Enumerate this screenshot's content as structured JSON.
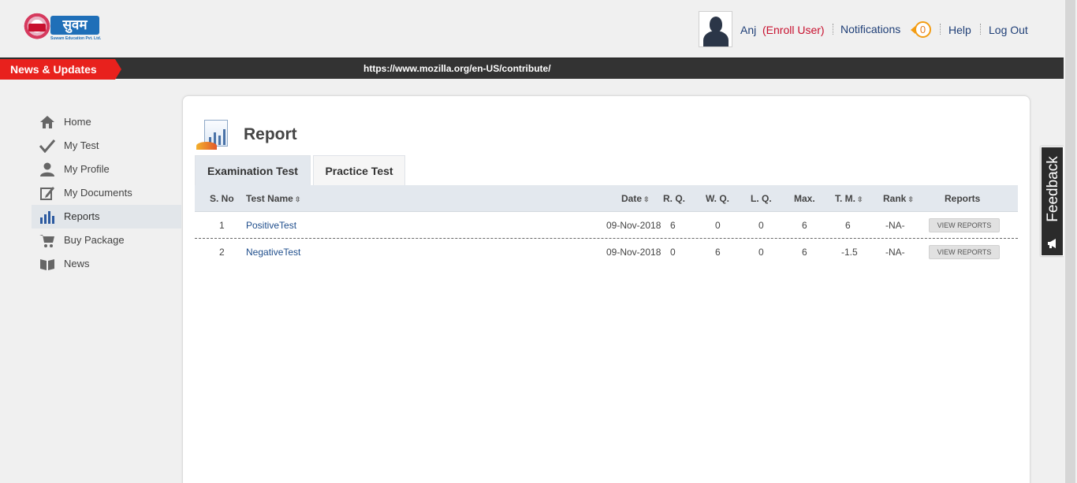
{
  "header": {
    "logo_word": "सुवम",
    "logo_subtitle": "Suwam Education Pvt. Ltd.",
    "user_name": "Anj",
    "user_role": "(Enroll User)",
    "notifications_label": "Notifications",
    "notifications_count": "0",
    "help_label": "Help",
    "logout_label": "Log Out"
  },
  "news": {
    "label": "News & Updates",
    "ticker": "https://www.mozilla.org/en-US/contribute/"
  },
  "sidebar": {
    "items": [
      {
        "label": "Home",
        "icon": "home-icon"
      },
      {
        "label": "My Test",
        "icon": "check-icon"
      },
      {
        "label": "My Profile",
        "icon": "user-icon"
      },
      {
        "label": "My Documents",
        "icon": "edit-document-icon"
      },
      {
        "label": "Reports",
        "icon": "bar-chart-icon",
        "active": true
      },
      {
        "label": "Buy Package",
        "icon": "cart-icon"
      },
      {
        "label": "News",
        "icon": "book-icon"
      }
    ]
  },
  "main": {
    "title": "Report",
    "tabs": [
      {
        "label": "Examination Test",
        "active": true
      },
      {
        "label": "Practice Test",
        "active": false
      }
    ],
    "columns": {
      "sno": "S. No",
      "test_name": "Test Name",
      "date": "Date",
      "rq": "R. Q.",
      "wq": "W. Q.",
      "lq": "L. Q.",
      "max": "Max.",
      "tm": "T. M.",
      "rank": "Rank",
      "reports": "Reports"
    },
    "rows": [
      {
        "sno": "1",
        "test_name": "PositiveTest",
        "date": "09-Nov-2018",
        "rq": "6",
        "wq": "0",
        "lq": "0",
        "max": "6",
        "tm": "6",
        "rank": "-NA-",
        "action": "VIEW REPORTS"
      },
      {
        "sno": "2",
        "test_name": "NegativeTest",
        "date": "09-Nov-2018",
        "rq": "0",
        "wq": "6",
        "lq": "0",
        "max": "6",
        "tm": "-1.5",
        "rank": "-NA-",
        "action": "VIEW REPORTS"
      }
    ]
  },
  "feedback": {
    "label": "Feedback"
  },
  "colors": {
    "news_red": "#e8211d",
    "news_bar": "#333333",
    "link_blue": "#1f4e8c",
    "role_red": "#c8102e",
    "notif_orange": "#f39c12"
  }
}
